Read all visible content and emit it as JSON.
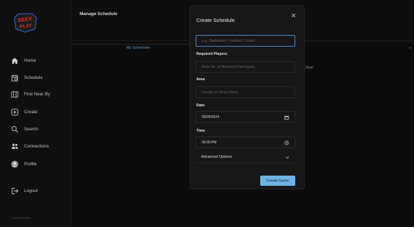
{
  "brand": {
    "logo_text": "SEEK PLAY",
    "logo_colors": [
      "#d93025",
      "#3a6fd8"
    ]
  },
  "sidebar": {
    "items": [
      {
        "label": "Home",
        "icon": "home-icon"
      },
      {
        "label": "Schedule",
        "icon": "calendar-icon"
      },
      {
        "label": "Find Near By",
        "icon": "map-icon"
      },
      {
        "label": "Create",
        "icon": "plus-circle-icon"
      },
      {
        "label": "Search",
        "icon": "search-icon"
      },
      {
        "label": "Connections",
        "icon": "people-icon"
      },
      {
        "label": "Profile",
        "icon": "avatar-icon"
      },
      {
        "label": "Logout",
        "icon": "logout-icon"
      }
    ],
    "copyright": "© 2024 Seek Play"
  },
  "header": {
    "title": "Manage Schedule"
  },
  "tabs": {
    "my_schedules": "My Schedules"
  },
  "background": {
    "now_text": "+ Now!",
    "right_clip": "f"
  },
  "modal": {
    "title": "Create Schedule",
    "sport": {
      "placeholder": "e.g., Badminton / Football / Cricket..."
    },
    "required_players": {
      "label": "Required Players",
      "placeholder": "Enter No. of Maximum Participants"
    },
    "area": {
      "label": "Area",
      "placeholder": "Locality or Venue Name"
    },
    "date": {
      "label": "Date",
      "value": "09/28/2024"
    },
    "time": {
      "label": "Time",
      "value": "05:00 PM"
    },
    "advanced": {
      "label": "Advanced Options"
    },
    "submit_label": "Create Game"
  },
  "colors": {
    "accent": "#6db3e3",
    "active_border": "#4f8fcf",
    "background": "#0b0b0b",
    "modal_bg": "#171717"
  }
}
